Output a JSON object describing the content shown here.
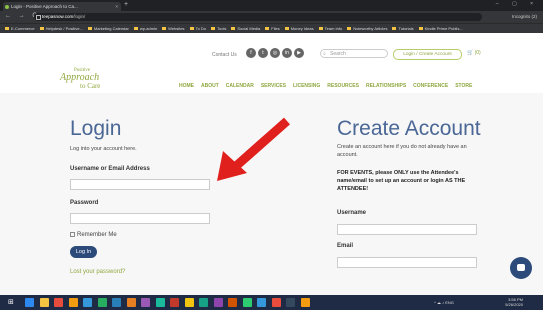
{
  "browser": {
    "tab_title": "Login - Positive Approach to Ca...",
    "tab_close": "×",
    "new_tab": "+",
    "window_controls": "– ▢ ×",
    "nav_buttons": "← → C ⌂",
    "url_host": "teepasnow.com",
    "url_path": "/login/",
    "profile_label": "Incognito (2)",
    "bookmarks": [
      "E-Commerce",
      "Helpdesk / Positive...",
      "Marketing Calendar",
      "wp-admin",
      "Websites",
      "To Do",
      "Tools",
      "Social Media",
      "Files",
      "Money Ideas",
      "Team Info",
      "Noteworthy Articles",
      "Tutorials",
      "Kindle Prime Publis..."
    ]
  },
  "header": {
    "contact_label": "Contact Us",
    "social_icons": [
      "facebook-icon",
      "twitter-icon",
      "instagram-icon",
      "linkedin-icon",
      "youtube-icon"
    ],
    "social_glyphs": [
      "f",
      "t",
      "◎",
      "in",
      "▶"
    ],
    "search_placeholder": "Search",
    "search_glyph": "⌕",
    "login_button": "Login / Create Account",
    "cart_label": "🛒 (0)",
    "logo": {
      "line1": "Positive",
      "line2": "Approach",
      "line3": "to Care"
    },
    "nav": [
      "HOME",
      "ABOUT",
      "CALENDAR",
      "SERVICES",
      "LICENSING",
      "RESOURCES",
      "RELATIONSHIPS",
      "CONFERENCE",
      "STORE"
    ]
  },
  "login": {
    "title": "Login",
    "subtitle": "Log into your account here.",
    "username_label": "Username or Email Address",
    "username_value": "",
    "password_label": "Password",
    "password_value": "",
    "remember_label": "Remember Me",
    "button": "Log In",
    "lost_password": "Lost your password?"
  },
  "create": {
    "title": "Create Account",
    "description": "Create an account here if you do not already have an account.",
    "events_notice": "FOR EVENTS, please ONLY use the Attendee's name/email to set up an account or login AS THE ATTENDEE!",
    "username_label": "Username",
    "email_label": "Email"
  },
  "colors": {
    "accent": "#8fa73f",
    "title_blue": "#4a6796",
    "button_navy": "#2c4a7a",
    "arrow_red": "#e0201c"
  },
  "taskbar": {
    "start_glyph": "⊞",
    "icon_colors": [
      "#2d89ef",
      "#f4c542",
      "#e74c3c",
      "#f39c12",
      "#3498db",
      "#27ae60",
      "#2980b9",
      "#e67e22",
      "#9b59b6",
      "#1abc9c",
      "#c0392b",
      "#f1c40f",
      "#16a085",
      "#8e44ad",
      "#d35400",
      "#2ecc71",
      "#3498db",
      "#e74c3c",
      "#34495e",
      "#f39c12"
    ],
    "tray_icons": "^ ☁ ♪ ENG",
    "time": "3:56 PM",
    "date": "5/26/2020"
  }
}
